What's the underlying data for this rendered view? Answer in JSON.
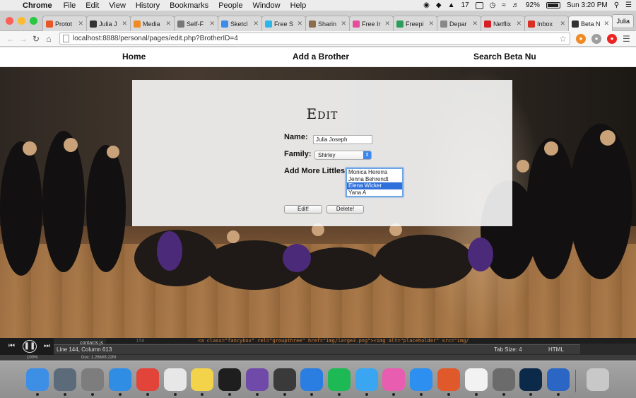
{
  "menubar": {
    "app": "Chrome",
    "items": [
      "File",
      "Edit",
      "View",
      "History",
      "Bookmarks",
      "People",
      "Window",
      "Help"
    ],
    "status": {
      "notification_count": "17",
      "battery": "92%",
      "clock": "Sun 3:20 PM"
    }
  },
  "browser": {
    "tabs": [
      {
        "label": "Protot",
        "icon": "gear-icon",
        "color": "#e8572a"
      },
      {
        "label": "Julia J",
        "icon": "github-icon",
        "color": "#333333"
      },
      {
        "label": "Media",
        "icon": "asterisk-icon",
        "color": "#f08a24"
      },
      {
        "label": "Self-F",
        "icon": "page-icon",
        "color": "#777777"
      },
      {
        "label": "Sketcl",
        "icon": "drive-icon",
        "color": "#3b8bea"
      },
      {
        "label": "Free S",
        "icon": "c-icon",
        "color": "#2fb6e8"
      },
      {
        "label": "Sharin",
        "icon": "bear-icon",
        "color": "#8a6d4b"
      },
      {
        "label": "Free Ir",
        "icon": "circle-icon",
        "color": "#e44d9b"
      },
      {
        "label": "Freepi",
        "icon": "f-icon",
        "color": "#2d9e59"
      },
      {
        "label": "Depar",
        "icon": "page-icon",
        "color": "#888888"
      },
      {
        "label": "Netflix",
        "icon": "netflix-icon",
        "color": "#d81f26"
      },
      {
        "label": "Inbox",
        "icon": "gmail-icon",
        "color": "#d93025"
      },
      {
        "label": "Beta N",
        "icon": "github-icon",
        "color": "#333333",
        "active": true
      }
    ],
    "profile_name": "Julia",
    "url": "localhost:8888/personal/pages/edit.php?BrotherID=4"
  },
  "site_nav": {
    "home": "Home",
    "add_brother": "Add a Brother",
    "search": "Search Beta Nu"
  },
  "form": {
    "title": "Edit",
    "name_label": "Name:",
    "name_value": "Julia Joseph",
    "family_label": "Family:",
    "family_value": "Shirley",
    "littles_label": "Add More Littles:",
    "littles_options": [
      "Monica Hererra",
      "Jenna Behrendt",
      "Elena Wicker",
      "Yana A"
    ],
    "littles_selected": "Elena Wicker",
    "edit_button": "Edit!",
    "delete_button": "Delete!"
  },
  "editor": {
    "line_number": "150",
    "code_line": "<a class=\"fancybox\" rel=\"groupthree\" href=\"img/large3.png\"><img alt=\"placeholder\" src=\"img/",
    "filename": "contacts.js",
    "cursor": "Line 144, Column 613",
    "tab_size": "Tab Size: 4",
    "language": "HTML",
    "zoom": "100%",
    "doc_size": "Doc: 1.28M/8.22M"
  },
  "dock": [
    {
      "name": "finder-icon",
      "color": "#3d8fe6"
    },
    {
      "name": "launchpad-icon",
      "color": "#5c6b7a"
    },
    {
      "name": "system-preferences-icon",
      "color": "#7d7d7d"
    },
    {
      "name": "safari-icon",
      "color": "#2f8de4"
    },
    {
      "name": "chrome-icon",
      "color": "#e2443a"
    },
    {
      "name": "slack-icon",
      "color": "#e7e7e7"
    },
    {
      "name": "stickies-icon",
      "color": "#f2d34a"
    },
    {
      "name": "terminal-icon",
      "color": "#1e1e1e"
    },
    {
      "name": "github-desktop-icon",
      "color": "#6f4aa8"
    },
    {
      "name": "sublime-text-icon",
      "color": "#3a3a3a"
    },
    {
      "name": "xcode-icon",
      "color": "#2a7de1"
    },
    {
      "name": "spotify-icon",
      "color": "#1db954"
    },
    {
      "name": "messages-icon",
      "color": "#3aa6f2"
    },
    {
      "name": "itunes-icon",
      "color": "#e85db0"
    },
    {
      "name": "app-store-icon",
      "color": "#2d8ff0"
    },
    {
      "name": "powerpoint-icon",
      "color": "#e0592a"
    },
    {
      "name": "photos-icon",
      "color": "#f2f2f2"
    },
    {
      "name": "evernote-icon",
      "color": "#6b6b6b"
    },
    {
      "name": "photoshop-icon",
      "color": "#0b2a4a"
    },
    {
      "name": "word-icon",
      "color": "#2b66c5"
    },
    {
      "name": "trash-icon",
      "color": "#c8c8c8"
    }
  ]
}
